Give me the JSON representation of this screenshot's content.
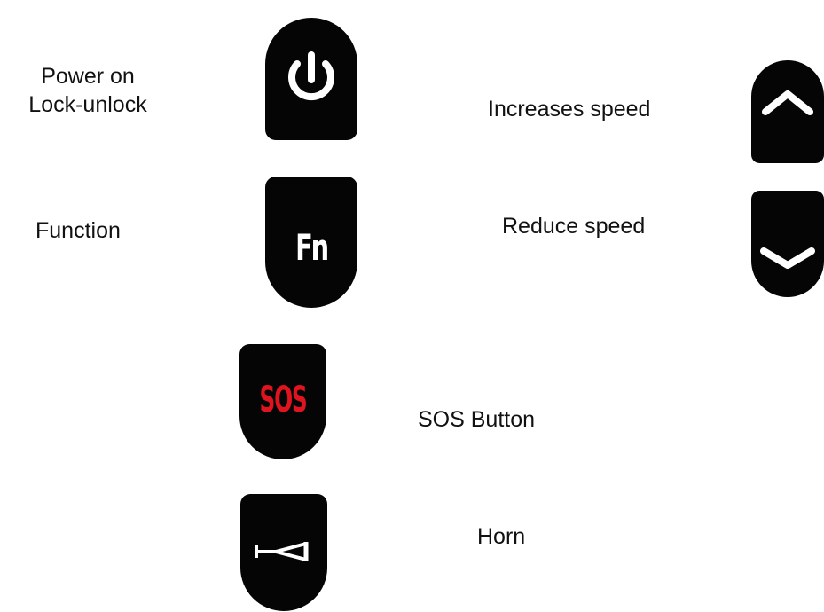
{
  "labels": {
    "power_line1": "Power on",
    "power_line2": "Lock-unlock",
    "function": "Function",
    "increase": "Increases speed",
    "reduce": "Reduce speed",
    "sos": "SOS Button",
    "horn": "Horn"
  },
  "buttons": {
    "fn_glyph": "Fn",
    "sos_glyph": "SOS"
  },
  "icons": {
    "power": "power-icon",
    "up": "chevron-up-icon",
    "down": "chevron-down-icon",
    "horn": "horn-icon"
  },
  "colors": {
    "button": "#050505",
    "icon": "#ffffff",
    "sos_text": "#e0141e",
    "label": "#111111"
  }
}
